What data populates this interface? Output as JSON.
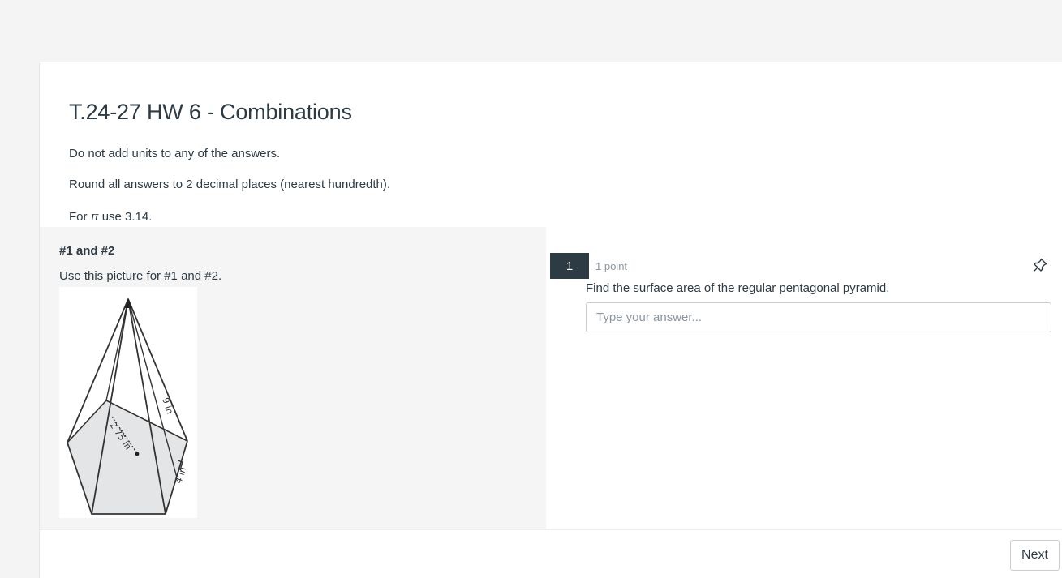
{
  "quiz": {
    "title": "T.24-27 HW 6 - Combinations",
    "instructions": {
      "line1": "Do not add units to any of the answers.",
      "line2": "Round all answers to 2 decimal places (nearest hundredth).",
      "line3_prefix": "For ",
      "line3_symbol": "π",
      "line3_suffix": " use 3.14."
    }
  },
  "stimulus": {
    "heading": "#1 and #2",
    "text": "Use this picture for #1 and #2.",
    "figure_labels": {
      "apothem": "2.75 in",
      "slant": "9 in",
      "side": "4 in"
    }
  },
  "question": {
    "number": "1",
    "points": "1 point",
    "text": "Find the surface area of the regular pentagonal pyramid.",
    "input_placeholder": "Type your answer...",
    "input_value": ""
  },
  "footer": {
    "next_label": "Next"
  },
  "icons": {
    "pin": "pin-icon"
  },
  "colors": {
    "accent_dark": "#2d3b45",
    "muted_text": "#8b969e",
    "stimulus_bg": "#f5f5f5"
  }
}
